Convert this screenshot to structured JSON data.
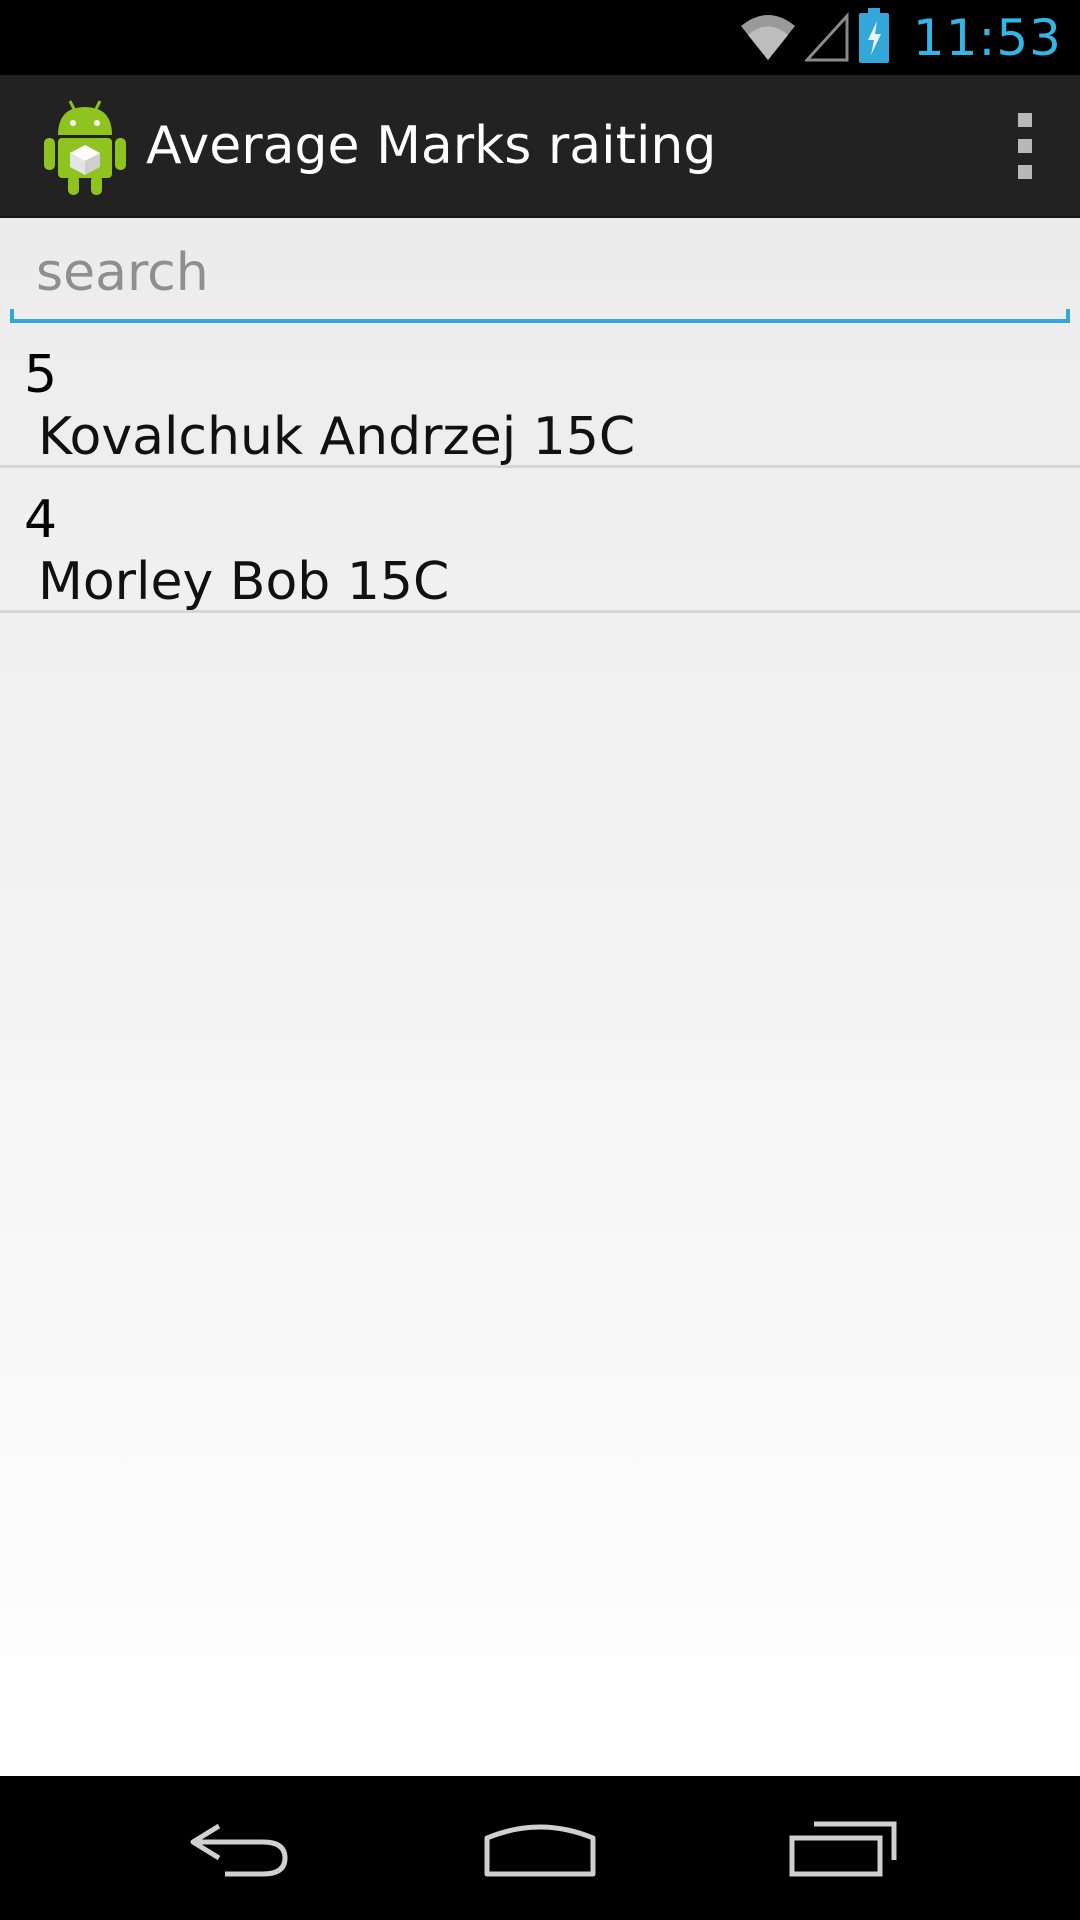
{
  "status_bar": {
    "time": "11:53",
    "time_color": "#33b5e5",
    "icons": [
      "wifi-icon",
      "signal-icon",
      "battery-charging-icon"
    ]
  },
  "action_bar": {
    "title": "Average Marks raiting",
    "app_icon": "android-robot-icon",
    "overflow_icon": "overflow-menu-icon"
  },
  "search": {
    "placeholder": "search",
    "value": "",
    "accent_color": "#33a8d8"
  },
  "list": {
    "items": [
      {
        "mark": "5",
        "name": "Kovalchuk Andrzej 15C"
      },
      {
        "mark": "4",
        "name": "Morley Bob 15C"
      }
    ]
  },
  "nav_bar": {
    "buttons": [
      "back-icon",
      "home-icon",
      "recent-apps-icon"
    ]
  }
}
